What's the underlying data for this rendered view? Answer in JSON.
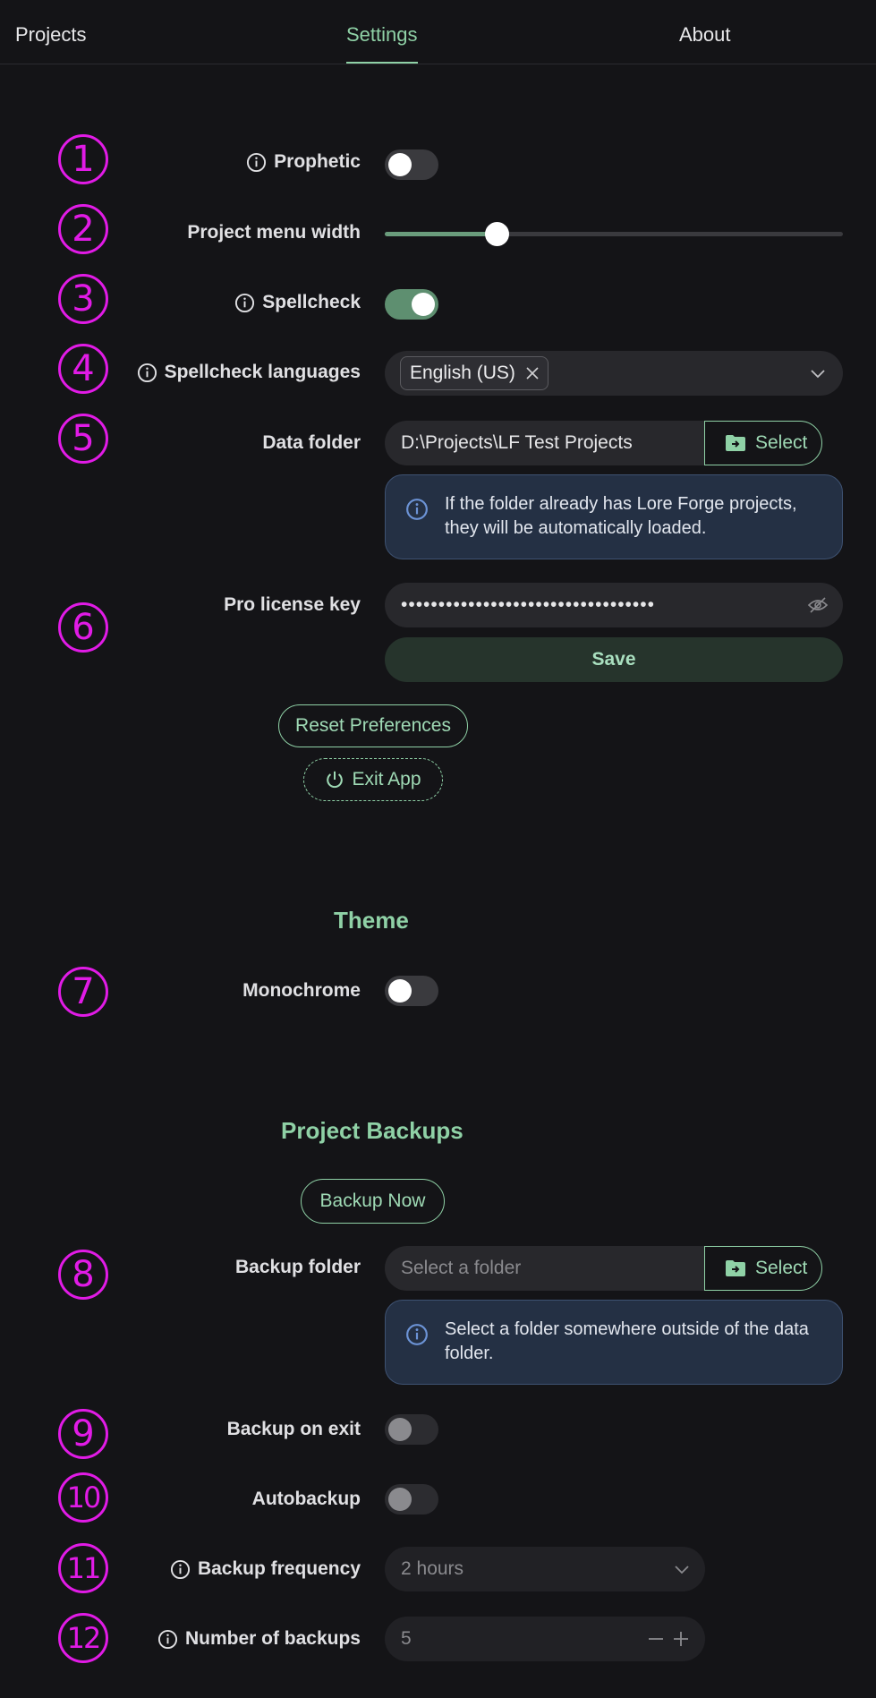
{
  "nav": {
    "tabs": [
      "Projects",
      "Settings",
      "About"
    ],
    "active": "Settings"
  },
  "markers": [
    "1",
    "2",
    "3",
    "4",
    "5",
    "6",
    "7",
    "8",
    "9",
    "10",
    "11",
    "12"
  ],
  "settings": {
    "prophetic": {
      "label": "Prophetic",
      "on": false
    },
    "menu_width": {
      "label": "Project menu width",
      "value_fraction": 0.245
    },
    "spellcheck": {
      "label": "Spellcheck",
      "on": true
    },
    "languages": {
      "label": "Spellcheck languages",
      "selected": "English (US)"
    },
    "data_folder": {
      "label": "Data folder",
      "value": "D:\\Projects\\LF Test Projects",
      "button": "Select",
      "alert": "If the folder already has Lore Forge projects, they will be automatically loaded."
    },
    "license": {
      "label": "Pro license key",
      "value": "••••••••••••••••••••••••••••••••••",
      "save": "Save"
    },
    "reset_button": "Reset Preferences",
    "exit_button": "Exit App"
  },
  "theme": {
    "title": "Theme",
    "monochrome": {
      "label": "Monochrome",
      "on": false
    }
  },
  "backups": {
    "title": "Project Backups",
    "backup_now": "Backup Now",
    "folder": {
      "label": "Backup folder",
      "placeholder": "Select a folder",
      "button": "Select",
      "alert": "Select a folder somewhere outside of the data folder."
    },
    "on_exit": {
      "label": "Backup on exit",
      "on": false
    },
    "autobackup": {
      "label": "Autobackup",
      "on": false
    },
    "frequency": {
      "label": "Backup frequency",
      "value": "2 hours"
    },
    "count": {
      "label": "Number of backups",
      "value": "5"
    }
  },
  "colors": {
    "accent": "#8fd1a6",
    "marker": "#e11be6",
    "background": "#141417",
    "info": "#243044"
  }
}
